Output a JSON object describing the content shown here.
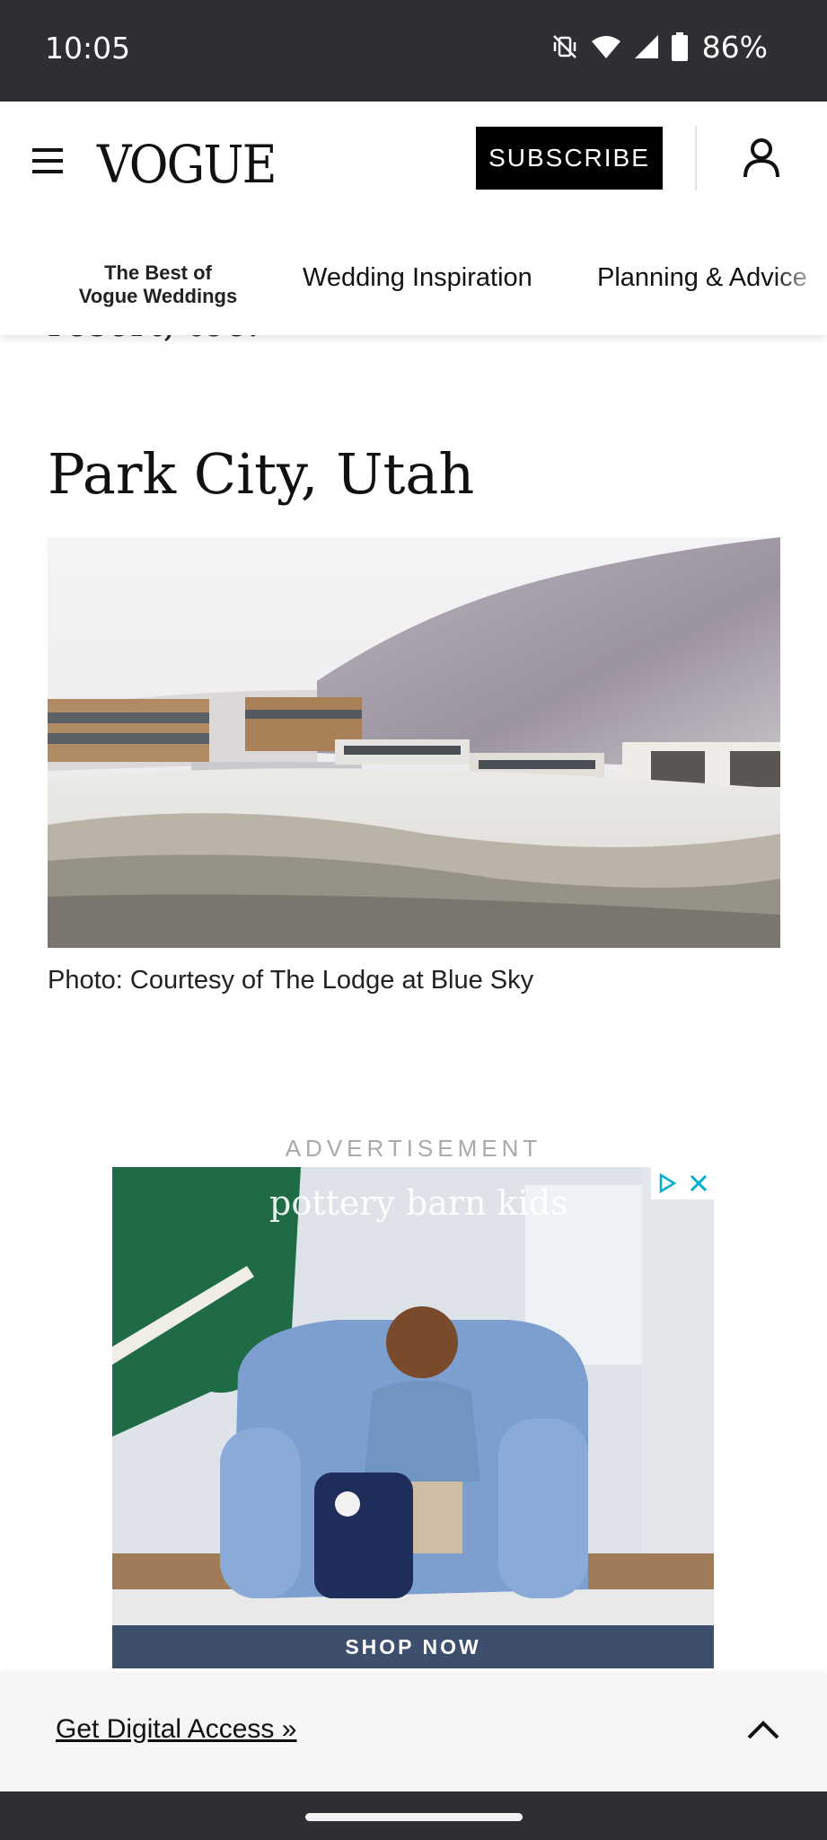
{
  "status_bar": {
    "time": "10:05",
    "battery": "86%",
    "icons": [
      "vibrate-off-icon",
      "wifi-icon",
      "signal-icon",
      "battery-icon"
    ]
  },
  "header": {
    "logo": "VOGUE",
    "subscribe_label": "SUBSCRIBE",
    "nav": {
      "best_line1": "The Best of",
      "best_line2": "Vogue Weddings",
      "items": [
        "Wedding Inspiration",
        "Planning & Advice"
      ]
    }
  },
  "article": {
    "cut_off_text": "resort, too.",
    "heading": "Park City, Utah",
    "photo_caption": "Photo: Courtesy of The Lodge at Blue Sky"
  },
  "ad": {
    "label": "ADVERTISEMENT",
    "brand": "pottery barn kids",
    "cta": "SHOP NOW"
  },
  "footer_bar": {
    "link": "Get Digital Access »"
  }
}
